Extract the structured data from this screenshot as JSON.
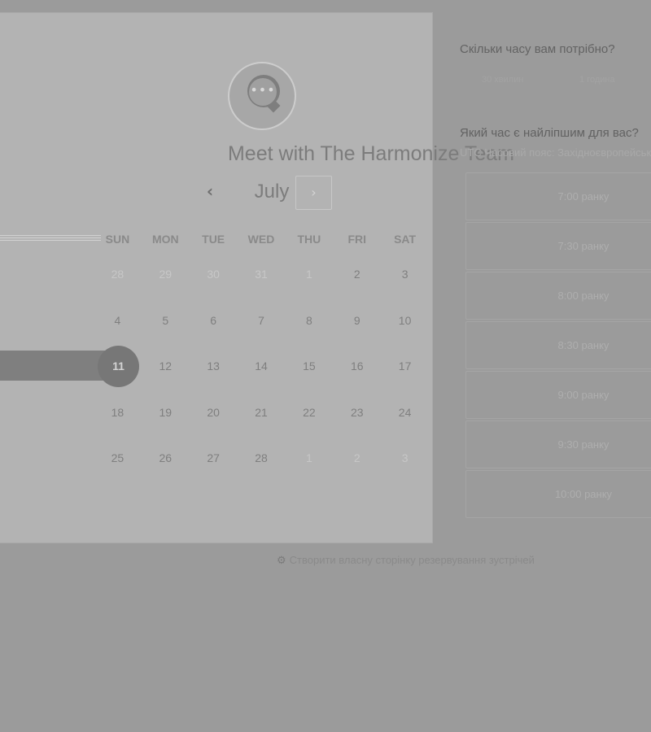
{
  "calendar": {
    "title": "Meet with The Harmonize Team",
    "month": "July",
    "prev_icon": "‹",
    "next_icon": "›",
    "weekdays": [
      "SUN",
      "MON",
      "TUE",
      "WED",
      "THU",
      "FRI",
      "SAT"
    ],
    "weeks": [
      [
        {
          "d": "28",
          "m": true
        },
        {
          "d": "29",
          "m": true
        },
        {
          "d": "30",
          "m": true
        },
        {
          "d": "31",
          "m": true
        },
        {
          "d": "1",
          "m": true
        },
        {
          "d": "2",
          "m": false
        },
        {
          "d": "3",
          "m": false
        }
      ],
      [
        {
          "d": "4",
          "m": false
        },
        {
          "d": "5",
          "m": false
        },
        {
          "d": "6",
          "m": false
        },
        {
          "d": "7",
          "m": false
        },
        {
          "d": "8",
          "m": false
        },
        {
          "d": "9",
          "m": false
        },
        {
          "d": "10",
          "m": false
        }
      ],
      [
        {
          "d": "11",
          "m": false,
          "s": true
        },
        {
          "d": "12",
          "m": false
        },
        {
          "d": "13",
          "m": false
        },
        {
          "d": "14",
          "m": false
        },
        {
          "d": "15",
          "m": false
        },
        {
          "d": "16",
          "m": false
        },
        {
          "d": "17",
          "m": false
        }
      ],
      [
        {
          "d": "18",
          "m": false
        },
        {
          "d": "19",
          "m": false
        },
        {
          "d": "20",
          "m": false
        },
        {
          "d": "21",
          "m": false
        },
        {
          "d": "22",
          "m": false
        },
        {
          "d": "23",
          "m": false
        },
        {
          "d": "24",
          "m": false
        }
      ],
      [
        {
          "d": "25",
          "m": false
        },
        {
          "d": "26",
          "m": false
        },
        {
          "d": "27",
          "m": false
        },
        {
          "d": "28",
          "m": false
        },
        {
          "d": "1",
          "m": true
        },
        {
          "d": "2",
          "m": true
        },
        {
          "d": "3",
          "m": true
        }
      ]
    ]
  },
  "right": {
    "duration_question": "Скільки часу вам потрібно?",
    "durations": [
      "30 хвилин",
      "1 година"
    ],
    "time_question": "Який час є найліпшим для вас?",
    "timezone": "UTC Часовий пояс: Західноєвропейський",
    "slots": [
      "7:00 ранку",
      "7:30 ранку",
      "8:00 ранку",
      "8:30 ранку",
      "9:00 ранку",
      "9:30 ранку",
      "10:00 ранку"
    ]
  },
  "footer": {
    "icon": "hubspot-icon",
    "text": "Створити власну сторінку резервування зустрічей"
  }
}
